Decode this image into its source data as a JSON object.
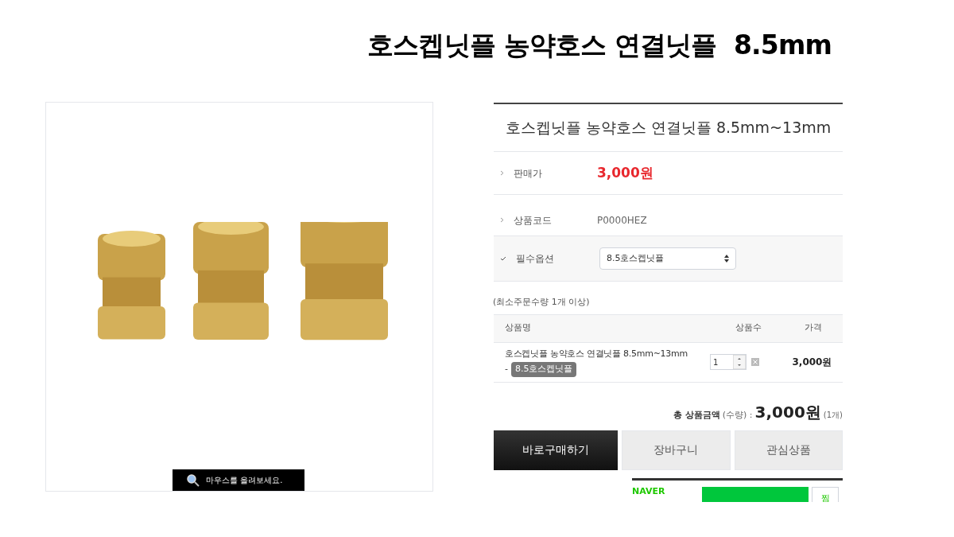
{
  "page_title": "호스켑닛플 농약호스 연결닛플  8.5mm",
  "image_panel": {
    "zoom_hint": "마우스를 올려보세요."
  },
  "product": {
    "name": "호스켑닛플 농약호스 연결닛플 8.5mm~13mm",
    "info_rows": [
      {
        "kind": "price",
        "label": "판매가",
        "value": "3,000원"
      },
      {
        "kind": "text",
        "label": "상품코드",
        "value": "P0000HEZ"
      },
      {
        "kind": "select",
        "label": "필수옵션",
        "value": "8.5호스켑닛플"
      }
    ],
    "min_order": "(최소주문수량 1개 이상)",
    "table": {
      "columns": [
        "상품명",
        "상품수",
        "가격"
      ],
      "rows": [
        {
          "name": "호스켑닛플 농약호스 연결닛플 8.5mm~13mm",
          "dash": "-",
          "option": "8.5호스켑닛플",
          "quantity": "1",
          "price": "3,000원"
        }
      ]
    },
    "total": {
      "label": "총 상품금액",
      "qty_label": "(수량) :",
      "amount": "3,000원",
      "count": "(1개)"
    },
    "buttons": [
      {
        "kind": "primary",
        "label": "바로구매하기"
      },
      {
        "kind": "secondary",
        "label": "장바구니"
      },
      {
        "kind": "secondary",
        "label": "관심상품"
      }
    ],
    "naver": {
      "brand": "NAVER",
      "wish": "찜"
    }
  }
}
